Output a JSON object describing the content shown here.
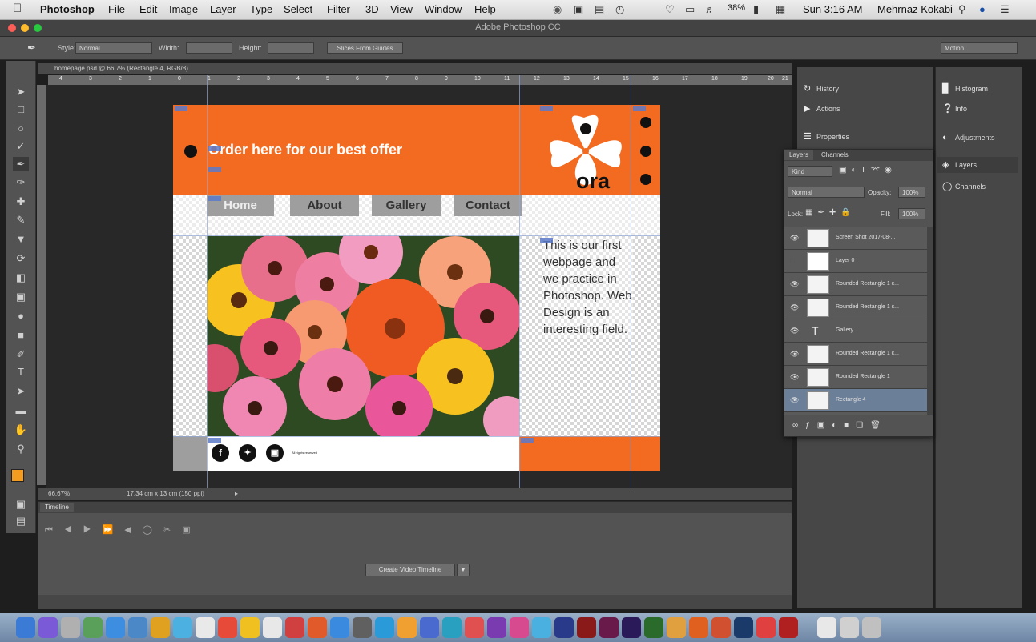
{
  "menubar": {
    "app_name": "Photoshop",
    "menus": [
      "File",
      "Edit",
      "Image",
      "Layer",
      "Type",
      "Select",
      "Filter",
      "3D",
      "View",
      "Window",
      "Help"
    ],
    "battery": "38%",
    "clock": "Sun 3:16 AM",
    "user": "Mehrnaz Kokabi"
  },
  "window": {
    "title": "Adobe Photoshop CC"
  },
  "options_bar": {
    "style_label": "Style:",
    "style_value": "Normal",
    "width_label": "Width:",
    "height_label": "Height:",
    "guides_button": "Slices From Guides",
    "workspace": "Motion"
  },
  "document": {
    "tab_title": "homepage.psd @ 66.7% (Rectangle 4, RGB/8)",
    "ruler_numbers": [
      "4",
      "3",
      "2",
      "1",
      "0",
      "1",
      "2",
      "3",
      "4",
      "5",
      "6",
      "7",
      "8",
      "9",
      "10",
      "11",
      "12",
      "13",
      "14",
      "15",
      "16",
      "17",
      "18",
      "19",
      "20",
      "21"
    ],
    "zoom": "66.67%",
    "doc_size": "17.34 cm x 13 cm (150 ppi)"
  },
  "webpage": {
    "offer_text": "Order here for our best offer",
    "logo_text": "ora",
    "nav": [
      "Home",
      "About",
      "Gallery",
      "Contact"
    ],
    "body_text": "This is our first webpage and we practice in Photoshop. Web Design is an interesting field.",
    "footer_text": "All rights reserved",
    "social_icons": [
      "f",
      "twitter",
      "instagram"
    ],
    "colors": {
      "orange": "#f26b21",
      "nav_gray": "#9e9e9e"
    }
  },
  "panels": {
    "mini": [
      "History",
      "Actions",
      "Properties"
    ],
    "strip": [
      "Histogram",
      "Info",
      "Adjustments",
      "Layers",
      "Channels"
    ],
    "layers_tabs": [
      "Layers",
      "Channels"
    ],
    "kind_label": "Kind",
    "blend_mode": "Normal",
    "opacity_label": "Opacity:",
    "opacity_value": "100%",
    "lock_label": "Lock:",
    "fill_label": "Fill:",
    "fill_value": "100%",
    "layers": [
      {
        "name": "Screen Shot 2017-08-...",
        "visible": true,
        "type": "smart"
      },
      {
        "name": "Layer 0",
        "visible": false,
        "type": "pixel"
      },
      {
        "name": "Rounded Rectangle 1 c...",
        "visible": true,
        "type": "shape"
      },
      {
        "name": "Rounded Rectangle 1 c...",
        "visible": true,
        "type": "shape"
      },
      {
        "name": "Gallery",
        "visible": true,
        "type": "text"
      },
      {
        "name": "Rounded Rectangle 1 c...",
        "visible": true,
        "type": "shape"
      },
      {
        "name": "Rounded Rectangle 1",
        "visible": true,
        "type": "shape"
      },
      {
        "name": "Rectangle 4",
        "visible": true,
        "type": "shape",
        "selected": true
      }
    ]
  },
  "timeline": {
    "tab": "Timeline",
    "create_button": "Create Video Timeline"
  }
}
